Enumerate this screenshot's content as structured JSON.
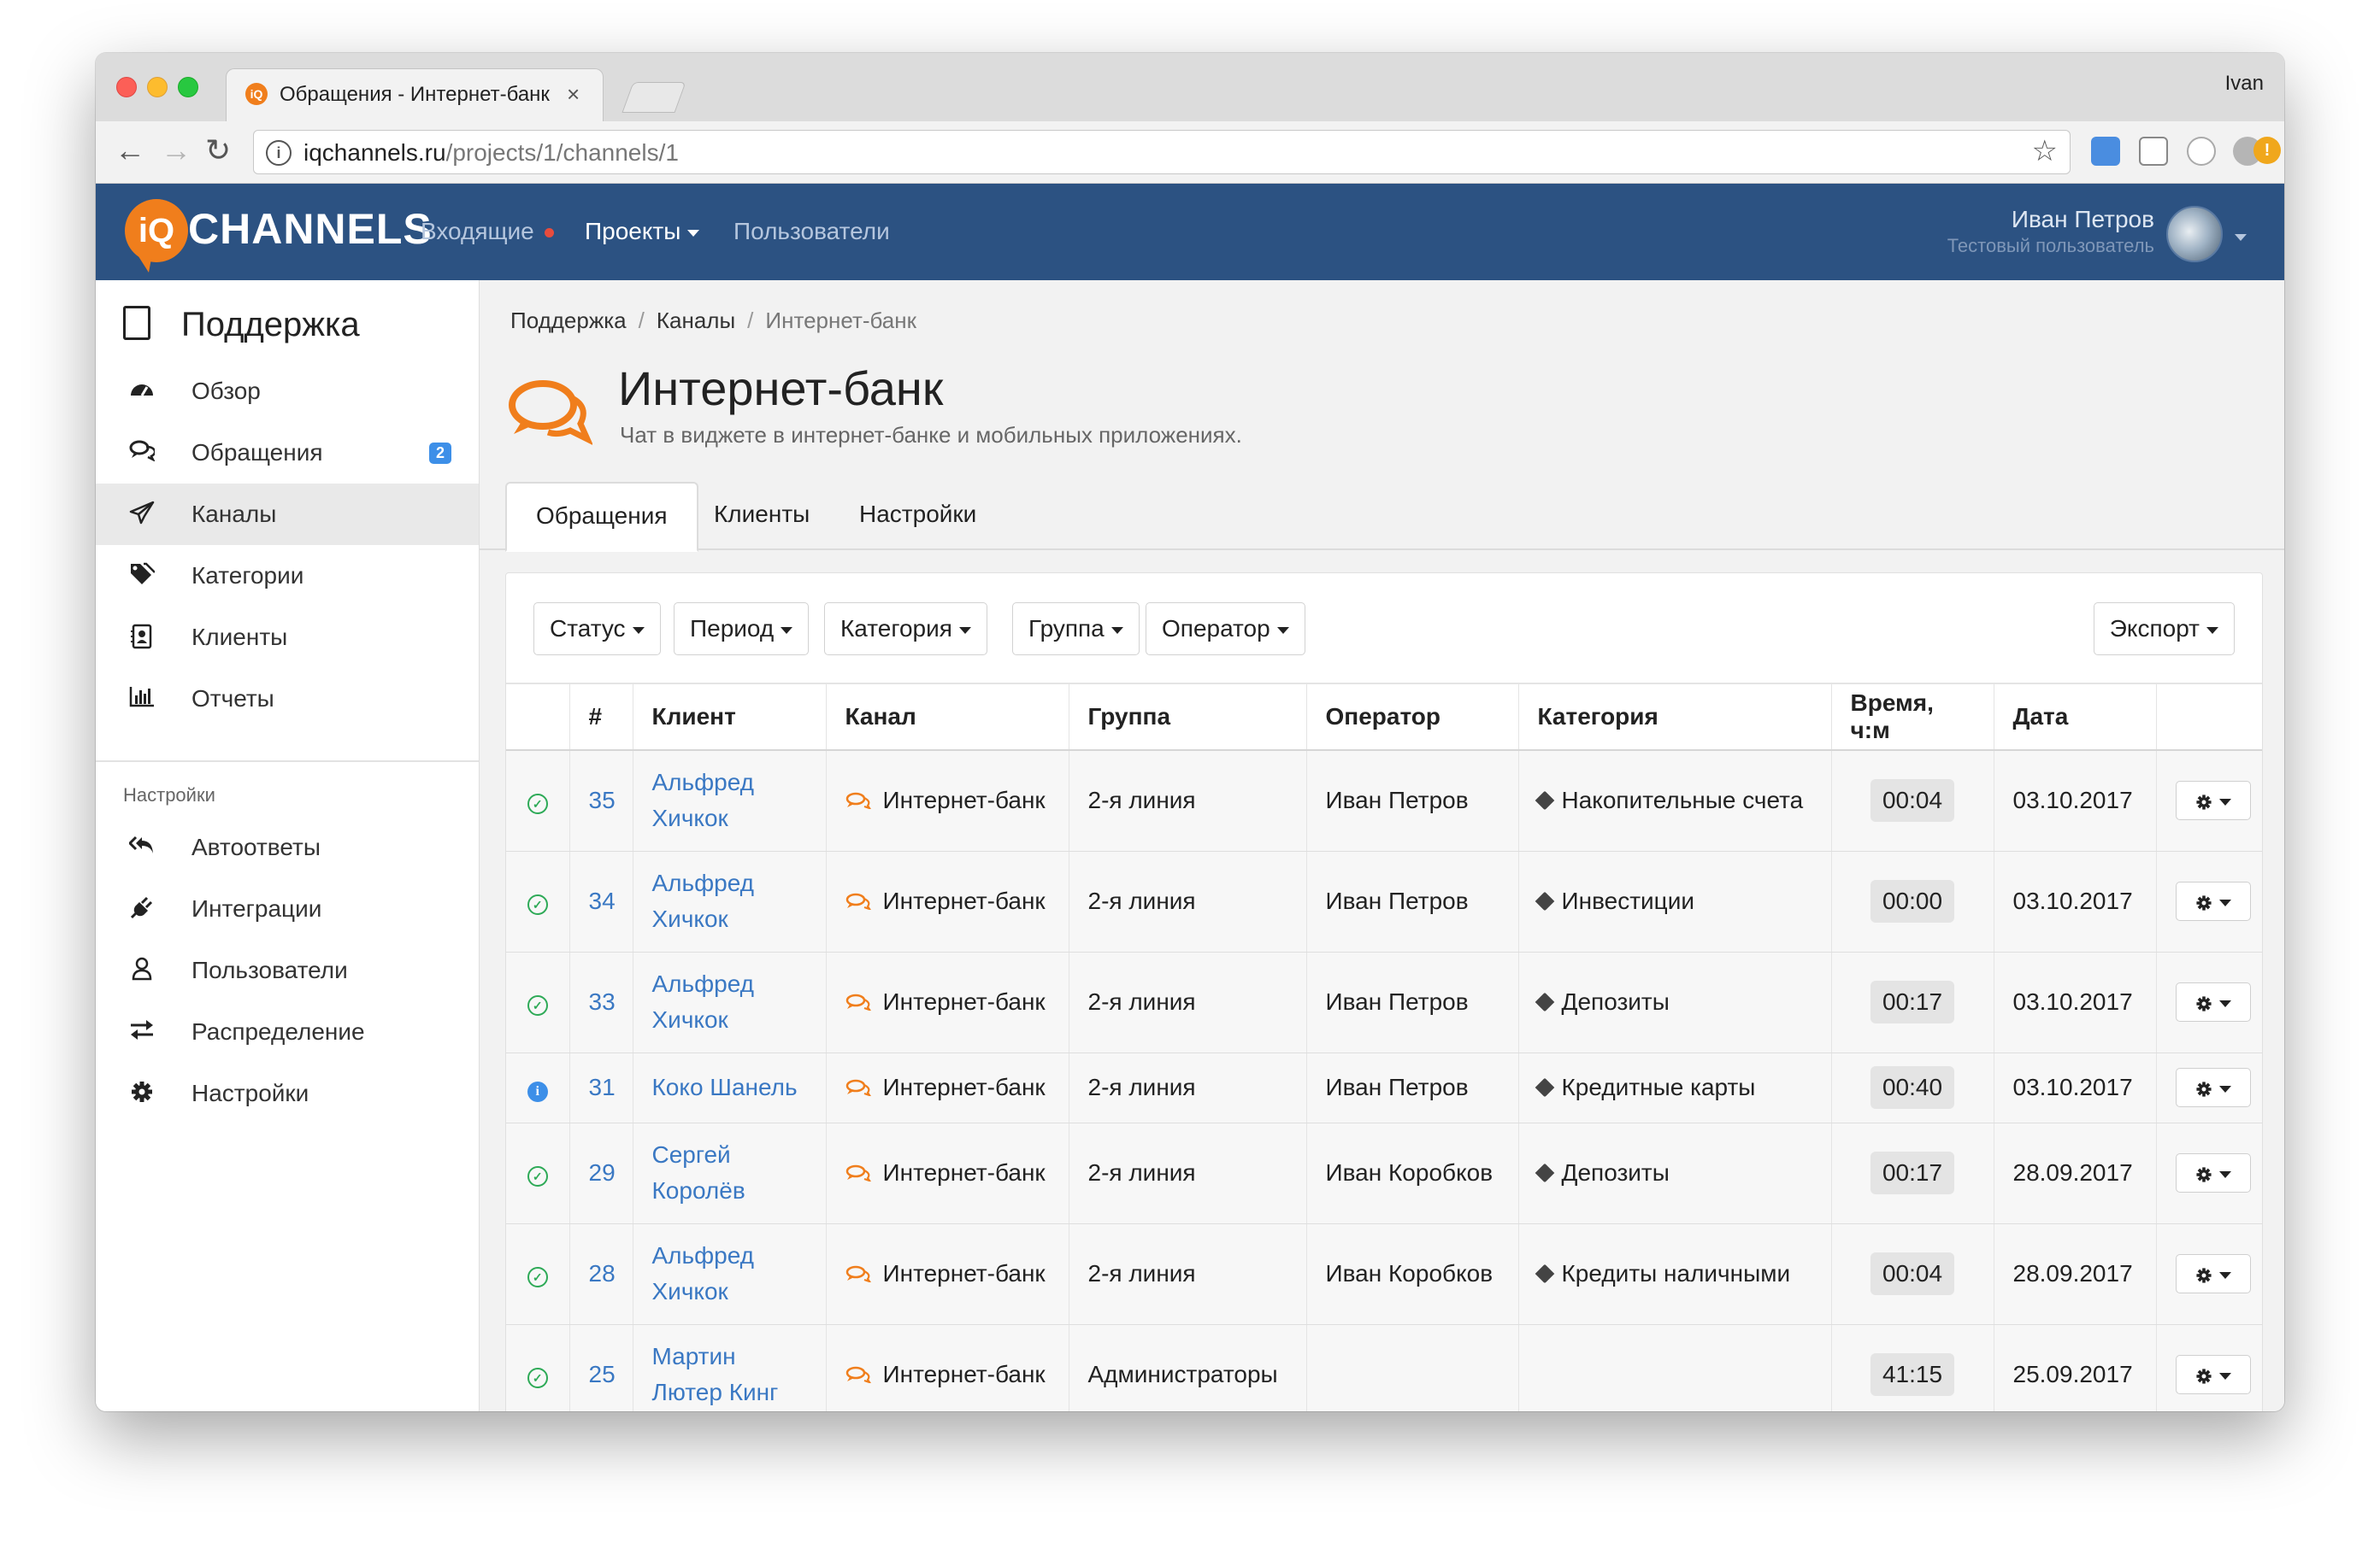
{
  "browser": {
    "tab_title": "Обращения - Интернет-банк",
    "favicon_text": "iQ",
    "profile": "Ivan",
    "url_host": "iqchannels.ru",
    "url_path": "/projects/1/channels/1"
  },
  "navbar": {
    "logo_mark": "iQ",
    "logo_text": "CHANNELS",
    "items": [
      {
        "label": "Входящие",
        "has_dot": true
      },
      {
        "label": "Проекты",
        "has_caret": true,
        "active": true
      },
      {
        "label": "Пользователи"
      }
    ],
    "user_name": "Иван Петров",
    "user_subtitle": "Тестовый пользователь"
  },
  "sidebar": {
    "title": "Поддержка",
    "items": [
      {
        "label": "Обзор",
        "icon": "dashboard-icon"
      },
      {
        "label": "Обращения",
        "icon": "chat-icon",
        "badge": "2"
      },
      {
        "label": "Каналы",
        "icon": "paper-plane-icon",
        "active": true
      },
      {
        "label": "Категории",
        "icon": "tags-icon"
      },
      {
        "label": "Клиенты",
        "icon": "contact-card-icon"
      },
      {
        "label": "Отчеты",
        "icon": "bar-chart-icon"
      }
    ],
    "settings_section": "Настройки",
    "settings_items": [
      {
        "label": "Автоответы",
        "icon": "reply-all-icon"
      },
      {
        "label": "Интеграции",
        "icon": "plug-icon"
      },
      {
        "label": "Пользователи",
        "icon": "user-icon"
      },
      {
        "label": "Распределение",
        "icon": "exchange-icon"
      },
      {
        "label": "Настройки",
        "icon": "gear-icon"
      }
    ]
  },
  "breadcrumb": [
    "Поддержка",
    "Каналы",
    "Интернет-банк"
  ],
  "page": {
    "title": "Интернет-банк",
    "description": "Чат в виджете в интернет-банке и мобильных приложениях."
  },
  "tabs": [
    "Обращения",
    "Клиенты",
    "Настройки"
  ],
  "filters": [
    "Статус",
    "Период",
    "Категория",
    "Группа",
    "Оператор"
  ],
  "export_label": "Экспорт",
  "table": {
    "headers": [
      "",
      "#",
      "Клиент",
      "Канал",
      "Группа",
      "Оператор",
      "Категория",
      "Время, ч:м",
      "Дата",
      ""
    ],
    "rows": [
      {
        "status": "ok",
        "num": "35",
        "client": "Альфред Хичкок",
        "channel": "Интернет-банк",
        "group": "2-я линия",
        "operator": "Иван Петров",
        "category": "Накопительные счета",
        "time": "00:04",
        "date": "03.10.2017"
      },
      {
        "status": "ok",
        "num": "34",
        "client": "Альфред Хичкок",
        "channel": "Интернет-банк",
        "group": "2-я линия",
        "operator": "Иван Петров",
        "category": "Инвестиции",
        "time": "00:00",
        "date": "03.10.2017"
      },
      {
        "status": "ok",
        "num": "33",
        "client": "Альфред Хичкок",
        "channel": "Интернет-банк",
        "group": "2-я линия",
        "operator": "Иван Петров",
        "category": "Депозиты",
        "time": "00:17",
        "date": "03.10.2017"
      },
      {
        "status": "info",
        "num": "31",
        "client": "Коко Шанель",
        "channel": "Интернет-банк",
        "group": "2-я линия",
        "operator": "Иван Петров",
        "category": "Кредитные карты",
        "time": "00:40",
        "date": "03.10.2017"
      },
      {
        "status": "ok",
        "num": "29",
        "client": "Сергей Королёв",
        "channel": "Интернет-банк",
        "group": "2-я линия",
        "operator": "Иван Коробков",
        "category": "Депозиты",
        "time": "00:17",
        "date": "28.09.2017"
      },
      {
        "status": "ok",
        "num": "28",
        "client": "Альфред Хичкок",
        "channel": "Интернет-банк",
        "group": "2-я линия",
        "operator": "Иван Коробков",
        "category": "Кредиты наличными",
        "time": "00:04",
        "date": "28.09.2017"
      },
      {
        "status": "ok",
        "num": "25",
        "client": "Мартин Лютер Кинг",
        "channel": "Интернет-банк",
        "group": "Администраторы",
        "operator": "",
        "category": "",
        "time": "41:15",
        "date": "25.09.2017"
      }
    ]
  },
  "colors": {
    "navbar_bg": "#2c5282",
    "brand_orange": "#f07e1c",
    "link_blue": "#3a78c3",
    "status_ok": "#2eaa57",
    "status_info": "#3d8fe8",
    "badge_blue": "#3d8fe8"
  }
}
